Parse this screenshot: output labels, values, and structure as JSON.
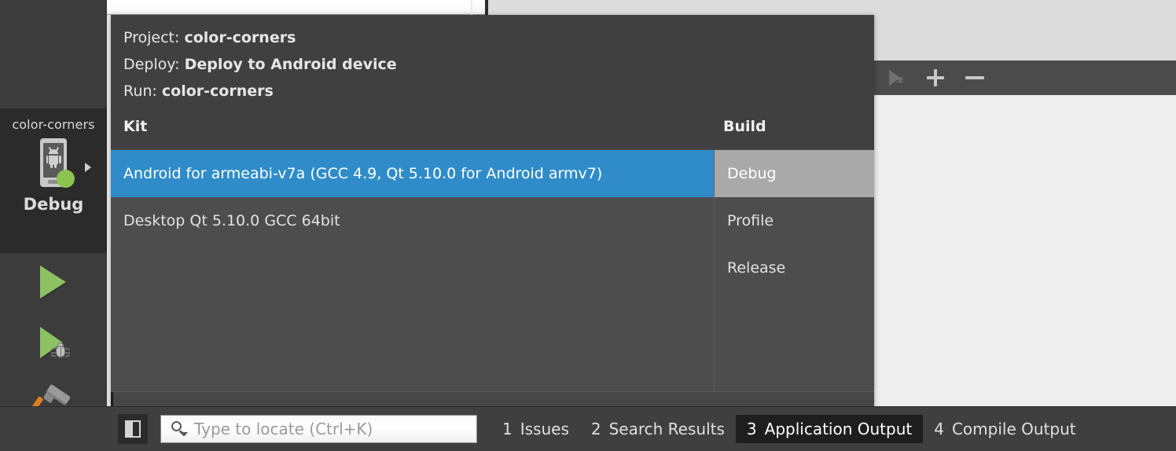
{
  "right_toolbar": {
    "icons": [
      {
        "name": "run-disabled-icon",
        "glyph": "3E"
      },
      {
        "name": "add-icon",
        "label": "+"
      },
      {
        "name": "remove-icon",
        "label": "−"
      }
    ]
  },
  "kit_selector": {
    "project_name": "color-corners",
    "build_config_name": "Debug",
    "device_icon": "android-device-icon",
    "status_dot_color": "#8dc351",
    "expand_arrow": "chevron-right-icon"
  },
  "mode_buttons": [
    {
      "name": "run-button",
      "icon": "play-icon",
      "color": "#8dc264"
    },
    {
      "name": "debug-button",
      "icon": "play-bug-icon",
      "color": "#8dc264"
    },
    {
      "name": "build-button",
      "icon": "hammer-icon",
      "color": "#e08020"
    }
  ],
  "popup": {
    "summary": [
      {
        "label": "Project:",
        "value": "color-corners"
      },
      {
        "label": "Deploy:",
        "value": "Deploy to Android device"
      },
      {
        "label": "Run:",
        "value": "color-corners"
      }
    ],
    "headers": {
      "kit": "Kit",
      "build": "Build"
    },
    "kits": [
      {
        "label": "Android for armeabi-v7a (GCC 4.9, Qt 5.10.0 for Android armv7)",
        "state": "selected"
      },
      {
        "label": "Desktop Qt 5.10.0 GCC 64bit",
        "state": "normal"
      }
    ],
    "builds": [
      {
        "label": "Debug",
        "state": "hovered"
      },
      {
        "label": "Profile",
        "state": "normal"
      },
      {
        "label": "Release",
        "state": "normal"
      }
    ],
    "selection_color": "#2f8cc9",
    "hover_color": "#a9a9a9"
  },
  "statusbar": {
    "sidebar_toggle": "sidebar-toggle-icon",
    "locator": {
      "icon": "search-icon",
      "placeholder": "Type to locate (Ctrl+K)",
      "value": ""
    },
    "tabs": [
      {
        "num": "1",
        "label": "Issues",
        "active": false
      },
      {
        "num": "2",
        "label": "Search Results",
        "active": false
      },
      {
        "num": "3",
        "label": "Application Output",
        "active": true
      },
      {
        "num": "4",
        "label": "Compile Output",
        "active": false
      }
    ]
  }
}
